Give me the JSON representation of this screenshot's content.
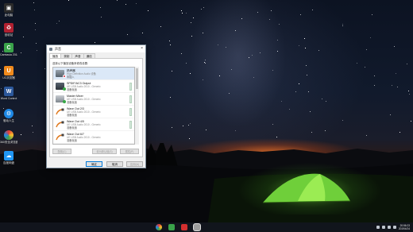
{
  "desktop_icons": [
    {
      "label": "此电脑",
      "icon": "computer-icon",
      "color": "#2a2a2a"
    },
    {
      "label": "回收站",
      "icon": "recycle-bin-icon",
      "color": "#b02030"
    },
    {
      "label": "Camtasia 2018",
      "icon": "camtasia-icon",
      "color": "#3aa34a"
    },
    {
      "label": "UC浏览器",
      "icon": "uc-browser-icon",
      "color": "#f08a1c"
    },
    {
      "label": "Word Control",
      "icon": "word-icon",
      "color": "#2b579a"
    },
    {
      "label": "驱动人生",
      "icon": "driver-icon",
      "color": "#1e88e5"
    },
    {
      "label": "360安全浏览器",
      "icon": "360-browser-icon",
      "color": "#e53935"
    },
    {
      "label": "百度网盘",
      "icon": "baidu-netdisk-icon",
      "color": "#2196f3"
    }
  ],
  "dialog": {
    "title": "声音",
    "close_glyph": "×",
    "tabs": [
      "播放",
      "录制",
      "声音",
      "通信"
    ],
    "instruction": "选择以下播放设备来修改设置:",
    "devices": [
      {
        "name": "扬声器",
        "desc": "High Definition Audio 设备",
        "status": "未插入",
        "icon": "speaker-icon",
        "state": "error"
      },
      {
        "name": "SPDIF/AC3 Output",
        "desc": "UE USB Audio 2010 - Generic",
        "status": "准备就绪",
        "icon": "soundcard-icon",
        "state": "ready"
      },
      {
        "name": "Master Mixer",
        "desc": "UE USB Audio 2010 - Generic",
        "status": "准备就绪",
        "icon": "mixer-icon",
        "state": "ready"
      },
      {
        "name": "Wave Out 2/3",
        "desc": "UE USB Audio 2010 - Generic",
        "status": "准备就绪",
        "icon": "cable-icon",
        "state": "ready"
      },
      {
        "name": "Wave Out 4/5",
        "desc": "UE USB Audio 2010 - Generic",
        "status": "准备就绪",
        "icon": "cable-icon",
        "state": "ready"
      },
      {
        "name": "Wave Out 6/7",
        "desc": "UE USB Audio 2010 - Generic",
        "status": "准备就绪",
        "icon": "cable-icon",
        "state": "ready"
      }
    ],
    "configure_label": "配置(C)",
    "set_default_label": "设为默认值(S)",
    "properties_label": "属性(P)",
    "ok_label": "确定",
    "cancel_label": "取消",
    "apply_label": "应用(A)"
  },
  "taskbar": {
    "apps": [
      {
        "icon": "chrome-icon",
        "color": "#4caf50"
      },
      {
        "icon": "camtasia-icon",
        "color": "#3aa34a"
      },
      {
        "icon": "recorder-icon",
        "color": "#d32f2f"
      },
      {
        "icon": "sound-settings-icon",
        "color": "#9e9e9e"
      }
    ],
    "time": "20:56:23",
    "date": "2019/4/24"
  },
  "colors": {
    "accent": "#0078d7",
    "tent_glow": "#7edc3c",
    "horizon": "#ff7a28"
  }
}
